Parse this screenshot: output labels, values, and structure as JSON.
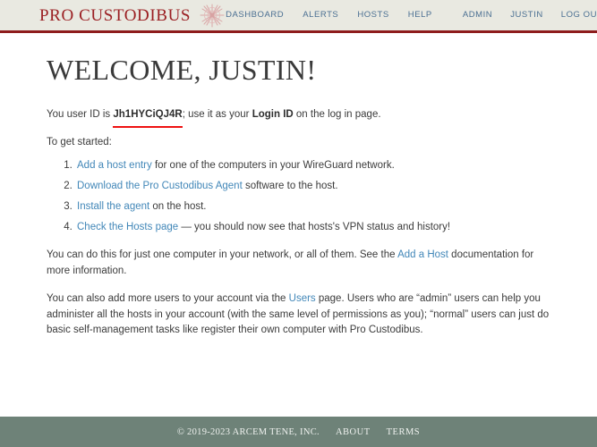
{
  "header": {
    "brand": {
      "name": "PRO CUSTODIBUS",
      "ornament_icon": "thistle-starburst-icon",
      "color": "#9b2023"
    },
    "nav_main": [
      {
        "label": "DASHBOARD",
        "name": "nav-dashboard"
      },
      {
        "label": "ALERTS",
        "name": "nav-alerts"
      },
      {
        "label": "HOSTS",
        "name": "nav-hosts"
      },
      {
        "label": "HELP",
        "name": "nav-help"
      }
    ],
    "nav_user": [
      {
        "label": "ADMIN",
        "name": "nav-admin"
      },
      {
        "label": "JUSTIN",
        "name": "nav-account-justin"
      },
      {
        "label": "LOG OUT",
        "name": "nav-log-out"
      }
    ],
    "background": "#e9e9e1",
    "border_color": "#8e1c1c",
    "link_color": "#4a6f92"
  },
  "main": {
    "title": "WELCOME, JUSTIN!",
    "userid_line": {
      "prefix": "You user ID is ",
      "user_id": "Jh1HYCiQJ4R",
      "middle": "; use it as your ",
      "login_id_label": "Login ID",
      "suffix": " on the log in page.",
      "underline_color": "#ee1111"
    },
    "get_started_label": "To get started:",
    "steps": [
      {
        "link": "Add a host entry",
        "rest": " for one of the computers in your WireGuard network."
      },
      {
        "link": "Download the Pro Custodibus Agent",
        "rest": " software to the host."
      },
      {
        "link": "Install the agent",
        "rest": " on the host."
      },
      {
        "link": "Check the Hosts page",
        "rest": " — you should now see that hosts's VPN status and history!"
      }
    ],
    "paragraph_2": {
      "before": "You can do this for just one computer in your network, or all of them. See the ",
      "link": "Add a Host",
      "after": " documentation for more information."
    },
    "paragraph_3": {
      "before": "You can also add more users to your account via the ",
      "link": "Users",
      "after": " page. Users who are “admin” users can help you administer all the hosts in your account (with the same level of permissions as you); “normal” users can just do basic self-management tasks like register their own computer with Pro Custodibus."
    },
    "link_color": "#4287b8"
  },
  "footer": {
    "copyright": "© 2019-2023 ARCEM TENE, INC.",
    "links": [
      {
        "label": "ABOUT",
        "name": "footer-link-about"
      },
      {
        "label": "TERMS",
        "name": "footer-link-terms"
      }
    ],
    "background": "#6e8278"
  }
}
